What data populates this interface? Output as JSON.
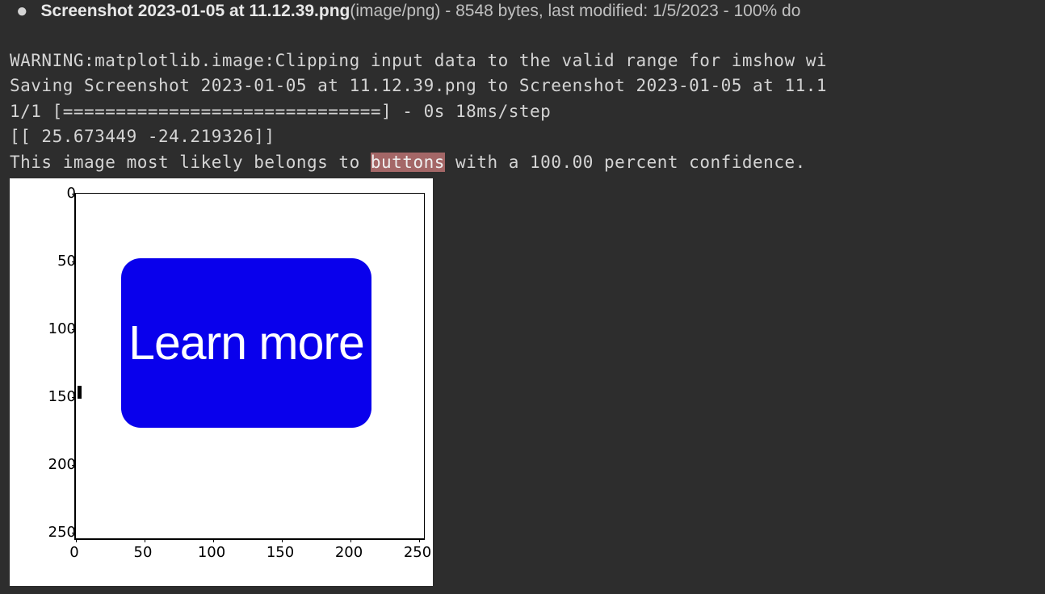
{
  "file_info": {
    "bullet": "●",
    "filename": "Screenshot 2023-01-05 at 11.12.39.png",
    "meta": "(image/png) - 8548 bytes, last modified: 1/5/2023 - 100% do"
  },
  "console": {
    "line1": "WARNING:matplotlib.image:Clipping input data to the valid range for imshow wi",
    "line2": "Saving Screenshot 2023-01-05 at 11.12.39.png to Screenshot 2023-01-05 at 11.1",
    "line3": "1/1 [==============================] - 0s 18ms/step",
    "line4": "[[ 25.673449 -24.219326]]",
    "line5_pre": "This image most likely belongs to ",
    "line5_highlight": "buttons",
    "line5_post": " with a 100.00 percent confidence."
  },
  "plot": {
    "button_label": "Learn more",
    "y_ticks": [
      "0",
      "50",
      "100",
      "150",
      "200",
      "250"
    ],
    "x_ticks": [
      "0",
      "50",
      "100",
      "150",
      "200",
      "250"
    ]
  },
  "chart_data": {
    "type": "image",
    "title": "",
    "xlabel": "",
    "ylabel": "",
    "xlim": [
      0,
      255
    ],
    "ylim": [
      255,
      0
    ],
    "content_description": "Blue rounded rectangle button labeled 'Learn more' centered on white 256x256 canvas, classified as 'buttons' with 100.00% confidence",
    "button_bbox_approx": {
      "x": 30,
      "y": 48,
      "width": 185,
      "height": 125
    },
    "classification": {
      "class": "buttons",
      "confidence_percent": 100.0,
      "logits": [
        25.673449,
        -24.219326
      ]
    }
  }
}
